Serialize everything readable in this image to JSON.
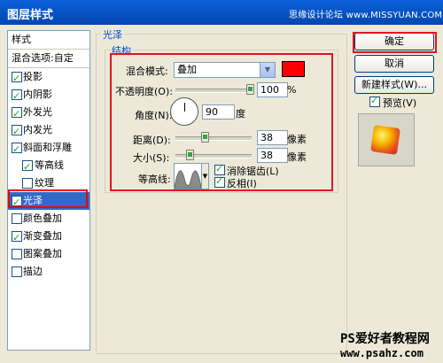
{
  "window": {
    "title": "图层样式",
    "watermark": "思缘设计论坛 www.MISSYUAN.COM"
  },
  "styles_panel": {
    "header": "样式",
    "blend_options": "混合选项:自定",
    "items": [
      {
        "label": "投影",
        "checked": true
      },
      {
        "label": "内阴影",
        "checked": true
      },
      {
        "label": "外发光",
        "checked": true
      },
      {
        "label": "内发光",
        "checked": true
      },
      {
        "label": "斜面和浮雕",
        "checked": true
      },
      {
        "label": "等高线",
        "checked": true
      },
      {
        "label": "纹理",
        "checked": false
      },
      {
        "label": "光泽",
        "checked": true
      },
      {
        "label": "颜色叠加",
        "checked": false
      },
      {
        "label": "渐变叠加",
        "checked": true
      },
      {
        "label": "图案叠加",
        "checked": false
      },
      {
        "label": "描边",
        "checked": false
      }
    ],
    "selected": "光泽"
  },
  "satin": {
    "group_title": "光泽",
    "structure_title": "结构",
    "blend_mode_label": "混合模式:",
    "blend_mode_value": "叠加",
    "color": "#ff0000",
    "opacity_label": "不透明度(O):",
    "opacity_value": "100",
    "opacity_unit": "%",
    "opacity_level": 1.0,
    "angle_label": "角度(N):",
    "angle_value": "90",
    "angle_unit": "度",
    "distance_label": "距离(D):",
    "distance_value": "38",
    "distance_unit": "像素",
    "size_label": "大小(S):",
    "size_value": "38",
    "size_unit": "像素",
    "contour_label": "等高线:",
    "anti_alias_label": "消除锯齿(L)",
    "anti_alias_checked": true,
    "invert_label": "反相(I)",
    "invert_checked": true
  },
  "buttons": {
    "ok": "确定",
    "cancel": "取消",
    "new_style": "新建样式(W)...",
    "preview_label": "预览(V)",
    "preview_checked": true
  },
  "footer": {
    "site_name": "PS爱好者教程网",
    "site_url": "www.psahz.com"
  }
}
